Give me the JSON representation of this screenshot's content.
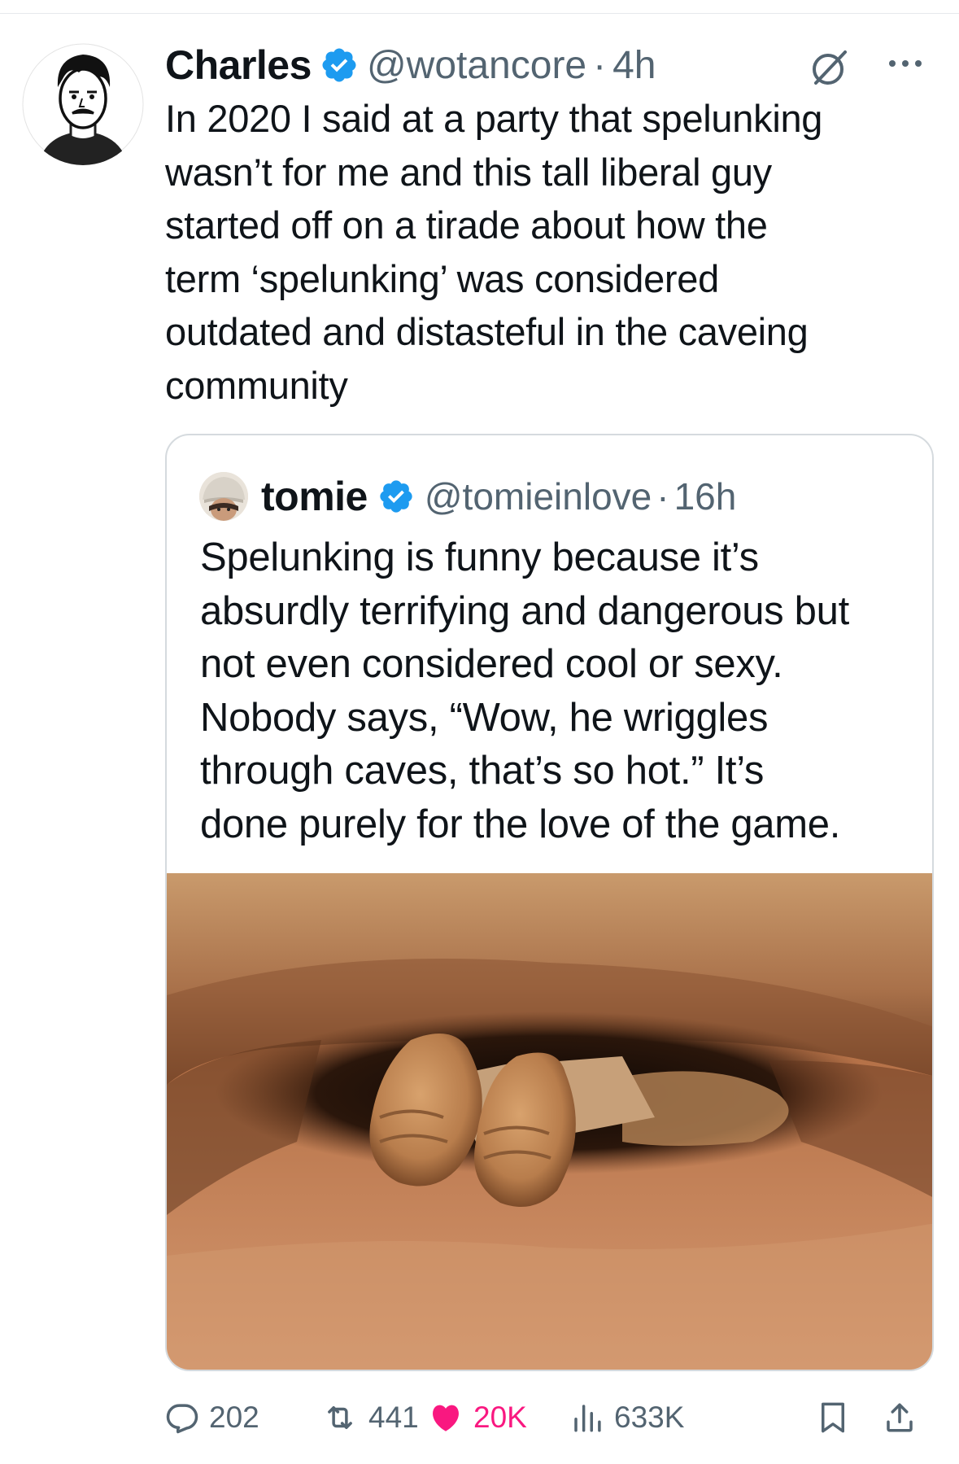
{
  "tweet": {
    "author_name": "Charles",
    "handle": "@wotancore",
    "separator": "·",
    "time": "4h",
    "text": "In 2020 I said at a party that spelunking\nwasn’t for me and this tall liberal guy\nstarted off on a tirade about how the\nterm ‘spelunking’ was considered\noutdated and distasteful in the caveing\ncommunity"
  },
  "quote": {
    "author_name": "tomie",
    "handle": "@tomieinlove",
    "separator": "·",
    "time": "16h",
    "text": "Spelunking is funny because it’s\nabsurdly terrifying and dangerous but\nnot even considered cool or sexy.\nNobody says, “Wow, he wriggles\nthrough caves, that’s so hot.” It’s\ndone purely for the love of the game."
  },
  "metrics": {
    "replies": "202",
    "reposts": "441",
    "likes": "20K",
    "views": "633K"
  },
  "colors": {
    "verified": "#1d9bf0",
    "like": "#f91880",
    "secondary_text": "#536471"
  },
  "icons": [
    "verified-badge-icon",
    "grok-icon",
    "more-icon",
    "reply-icon",
    "repost-icon",
    "like-icon",
    "views-icon",
    "bookmark-icon",
    "share-icon"
  ]
}
